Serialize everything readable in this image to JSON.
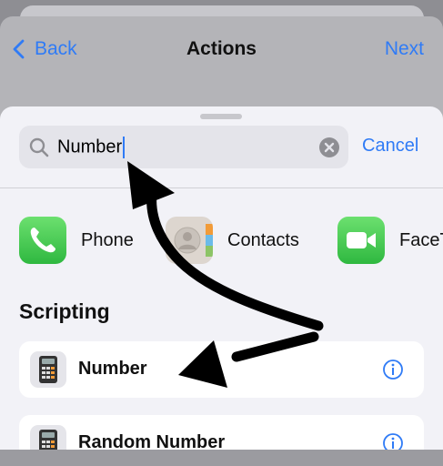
{
  "nav": {
    "back_label": "Back",
    "title": "Actions",
    "next_label": "Next"
  },
  "search": {
    "value": "Number",
    "cancel_label": "Cancel"
  },
  "apps": [
    {
      "label": "Phone",
      "icon": "phone-icon"
    },
    {
      "label": "Contacts",
      "icon": "contacts-icon"
    },
    {
      "label": "FaceTime",
      "icon": "facetime-icon"
    }
  ],
  "section": {
    "title": "Scripting"
  },
  "results": [
    {
      "label": "Number",
      "icon": "calculator-icon"
    },
    {
      "label": "Random Number",
      "icon": "calculator-icon"
    }
  ],
  "colors": {
    "accent": "#2f7bf6",
    "annotation": "#000000"
  }
}
